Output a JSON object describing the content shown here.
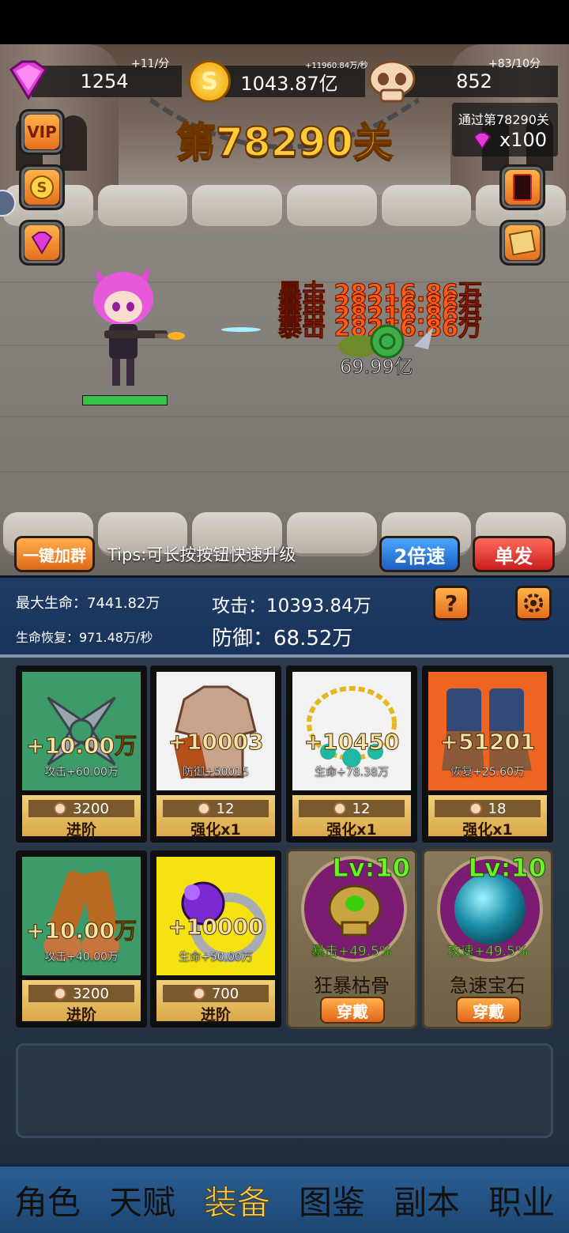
{
  "resources": {
    "gems": {
      "value": "1254",
      "rate": "+11/分"
    },
    "gold": {
      "value": "1043.87亿",
      "rate": "+11960.84万/秒"
    },
    "skulls": {
      "value": "852",
      "rate": "+83/10分"
    }
  },
  "stage": {
    "title": "第78290关",
    "reward_label": "通过第78290关",
    "reward_amount": "x100"
  },
  "side_buttons": {
    "vip_label": "VIP"
  },
  "battle": {
    "damage_texts": [
      "暴击 28216.86万",
      "暴击 28216.86万",
      "暴击 28216.86万",
      "暴击 28216.86万"
    ],
    "enemy_hp": "69.99亿",
    "player_hp_fraction": 1.0
  },
  "controls": {
    "join_group": "一键加群",
    "tips": "Tips:可长按按钮快速升级",
    "speed": "2倍速",
    "fire_mode": "单发"
  },
  "stats": {
    "max_hp": "最大生命：7441.82万",
    "regen": "生命恢复：971.48万/秒",
    "attack": "攻击：10393.84万",
    "defense": "防御：68.52万",
    "help_label": "?"
  },
  "equipment": [
    {
      "name": "shuriken",
      "plus": "+10.00万",
      "substat": "攻击+60.00万",
      "cost": "3200",
      "action": "进阶",
      "bg": "#3d9b6a"
    },
    {
      "name": "armor",
      "plus": "+10003",
      "substat": "防御+50015",
      "cost": "12",
      "action": "强化x1",
      "bg": "#f2f2f2"
    },
    {
      "name": "necklace",
      "plus": "+10450",
      "substat": "生命+78.38万",
      "cost": "12",
      "action": "强化x1",
      "bg": "#f2f2f2"
    },
    {
      "name": "boots",
      "plus": "+51201",
      "substat": "恢复+25.60万",
      "cost": "18",
      "action": "强化x1",
      "bg": "#f06422"
    },
    {
      "name": "gloves",
      "plus": "+10.00万",
      "substat": "攻击+40.00万",
      "cost": "3200",
      "action": "进阶",
      "bg": "#3d9b6a"
    },
    {
      "name": "ring",
      "plus": "+10000",
      "substat": "生命+50.00万",
      "cost": "700",
      "action": "进阶",
      "bg": "#f5e210"
    }
  ],
  "gems": [
    {
      "level": "Lv:10",
      "bonus": "暴击+49.5%",
      "name": "狂暴枯骨",
      "button": "穿戴"
    },
    {
      "level": "Lv:10",
      "bonus": "攻速+49.5%",
      "name": "急速宝石",
      "button": "穿戴"
    }
  ],
  "nav": [
    "角色",
    "天赋",
    "装备",
    "图鉴",
    "副本",
    "职业"
  ],
  "nav_active_index": 2
}
